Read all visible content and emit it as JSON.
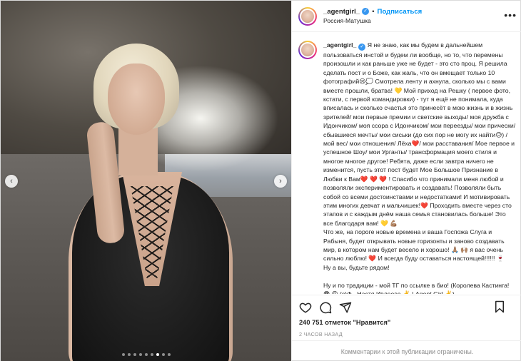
{
  "header": {
    "username": "_agentgirl_",
    "separator": "•",
    "follow_label": "Подписаться",
    "location": "Россия-Матушка",
    "more_label": "•••"
  },
  "media": {
    "prev_icon": "chevron-left-icon",
    "next_icon": "chevron-right-icon",
    "prev_glyph": "‹",
    "next_glyph": "›",
    "dot_count": 9,
    "active_dot": 6
  },
  "caption": {
    "username": "_agentgirl_",
    "text": "Я не знаю, как мы будем в дальнейшем пользоваться инстой и будем ли вообще, но то, что перемены произошли и как раньше уже не будет - это сто проц. Я решила сделать пост и о Боже, как жаль, что он вмещает только 10 фотографий😢💭 Смотрела ленту и ахнула, сколько мы с вами вместе прошли, братва! 💛 Мой приход на Решку ( первое фото, кстати, с первой командировки) - тут я ещё не понимала, куда вписалась и сколько счастья это принесёт в мою жизнь и в жизнь зрителей/ мои первые премии и светские выходы/ моя дружба с Идончиком/ моя ссора с Идончиком/ мои переезды/ мои прически/ сбывшиеся мечты/ мои сиськи (до сих пор не могу их найти😥) / мой вес/ мои отношения/ Лёха❤️/ мои расставания/ Мое первое и успешное Шоу/ мои Урганты/ трансформация моего стиля и многое многое другое! Ребята, даже если завтра ничего не изменится, пусть этот пост будет Мое Большое Признание в Любви к Вам❤️ ❤️ ❤️ ! Спасибо что принимали меня любой и позволяли экспериментировать и создавать! Позволяли быть собой со всеми достоинствами и недостатками! И мотивировать этим многих девчат и мальчишек!❤️ Проходить вместе через сто этапов и с каждым днём наша семья становилась больше! Это все благодаря вам! 💛 💪🏽\nЧто же, на пороге новые времена и ваша Госпожа Слуга и Рабыня, будет открывать новые горизонты и заново создавать мир, в котором нам будет весело и хорошо! 🙏🏽 🙌🏽 я вас очень сильно люблю! ❤️ И всегда буду оставаться настоящей!!!!!! 🍷\nНу а вы, будьте рядом!\n\nНу и по традиции - мой ТГ по ссылке в био! (Королева Кастинга! 😎 😝 (с)Ф - Настя Ивлеева ✌️ | Agent Girl ✌️)"
  },
  "actions": {
    "like_icon": "heart-icon",
    "comment_icon": "comment-icon",
    "share_icon": "share-icon",
    "save_icon": "bookmark-icon"
  },
  "likes": {
    "count": "240 751",
    "connector": "отметок",
    "label": "\"Нравится\""
  },
  "time": "2 ЧАСОВ НАЗАД",
  "comments_off": "Комментарии к этой публикации ограничены."
}
